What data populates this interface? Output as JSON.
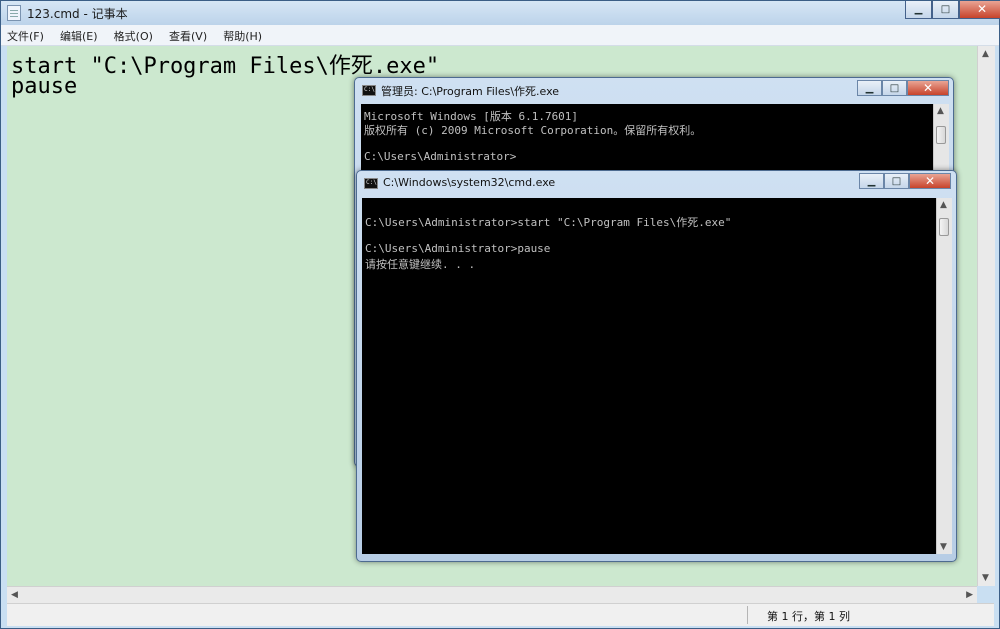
{
  "notepad": {
    "title": "123.cmd - 记事本",
    "controls": {
      "minimize": "▁",
      "maximize": "□",
      "close": "✕"
    },
    "menu": [
      "文件(F)",
      "编辑(E)",
      "格式(O)",
      "查看(V)",
      "帮助(H)"
    ],
    "lines": [
      "start \"C:\\Program Files\\作死.exe\"",
      "pause"
    ],
    "status": "第 1 行，第 1 列"
  },
  "cmd_back": {
    "title": "管理员: C:\\Program Files\\作死.exe",
    "controls": {
      "minimize": "▁",
      "maximize": "□",
      "close": "✕"
    },
    "lines": [
      "Microsoft Windows [版本 6.1.7601]",
      "版权所有 (c) 2009 Microsoft Corporation。保留所有权利。",
      "",
      "C:\\Users\\Administrator>"
    ]
  },
  "cmd_front": {
    "title": "C:\\Windows\\system32\\cmd.exe",
    "controls": {
      "minimize": "▁",
      "maximize": "□",
      "close": "✕"
    },
    "lines": [
      "",
      "C:\\Users\\Administrator>start \"C:\\Program Files\\作死.exe\"",
      "",
      "C:\\Users\\Administrator>pause",
      "请按任意键继续. . ."
    ]
  }
}
